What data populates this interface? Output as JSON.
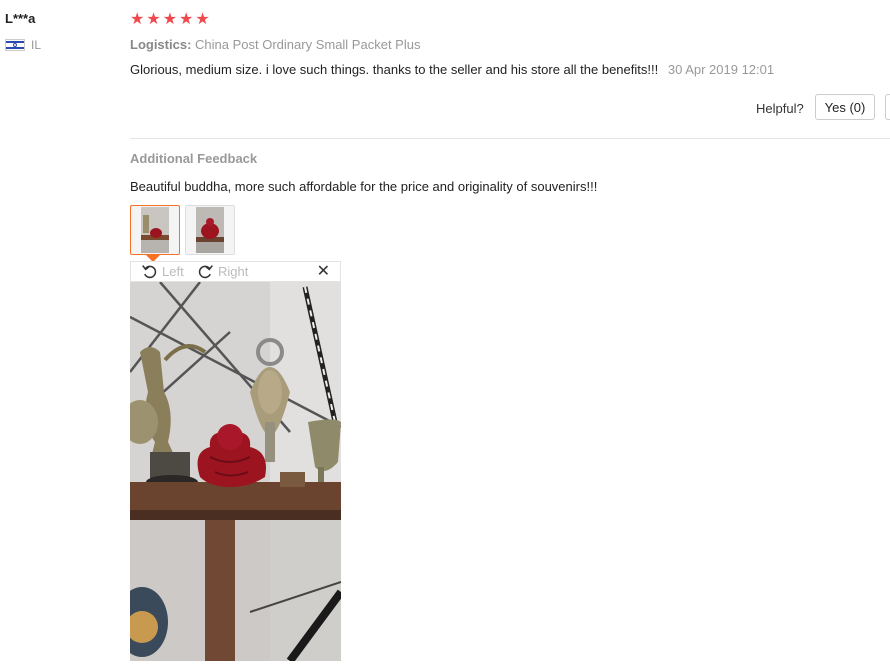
{
  "review": {
    "user_name": "L***a",
    "country_code": "IL",
    "rating": 5,
    "stars": [
      "★",
      "★",
      "★",
      "★",
      "★"
    ],
    "logistics_label": "Logistics:",
    "logistics_value": "China Post Ordinary Small Packet Plus",
    "text": "Glorious, medium size. i love such things. thanks to the seller and his store all the benefits!!!",
    "date": "30 Apr 2019 12:01",
    "helpful_label": "Helpful?",
    "yes_label": "Yes (0)"
  },
  "additional": {
    "title": "Additional Feedback",
    "text": "Beautiful buddha, more such affordable for the price and originality of souvenirs!!!"
  },
  "viewer": {
    "rotate_left": "Left",
    "rotate_right": "Right",
    "close_glyph": "✕"
  },
  "colors": {
    "star": "#f0494d",
    "accent": "#f57224",
    "buddha": "#9b1420"
  },
  "icons": [
    "israel-flag-icon",
    "star-icon",
    "rotate-left-icon",
    "rotate-right-icon",
    "close-icon"
  ]
}
